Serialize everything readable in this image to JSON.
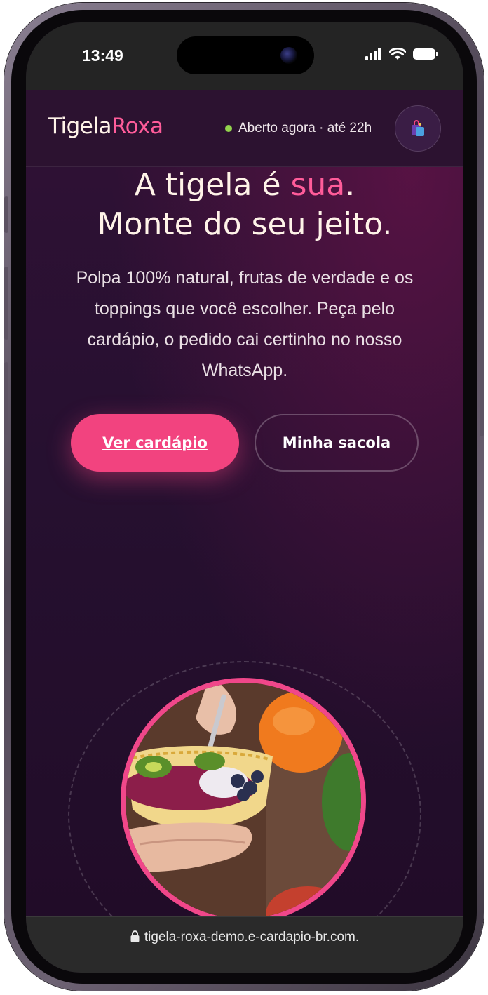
{
  "status_bar": {
    "time": "13:49"
  },
  "header": {
    "logo_part1": "Tigela",
    "logo_part2": "Roxa",
    "open_status": "Aberto agora · até 22h",
    "bag_icon": "shopping-bag-icon"
  },
  "hero": {
    "title_line1_a": "A tigela é ",
    "title_line1_highlight": "sua",
    "title_line1_b": ".",
    "title_line2": "Monte do seu jeito.",
    "subtitle": "Polpa 100% natural, frutas de verdade e os toppings que você escolher. Peça pelo cardápio, o pedido cai certinho no nosso WhatsApp.",
    "primary_button": "Ver cardápio",
    "secondary_button": "Minha sacola",
    "image_icon": "acai-bowl-photo"
  },
  "browser": {
    "url": "tigela-roxa-demo.e-cardapio-br.com.",
    "lock_icon": "lock-icon"
  },
  "colors": {
    "accent_pink": "#f2437f",
    "logo_pink": "#ff5c9a",
    "background_purple": "#261030",
    "open_dot_green": "#93d34d"
  }
}
